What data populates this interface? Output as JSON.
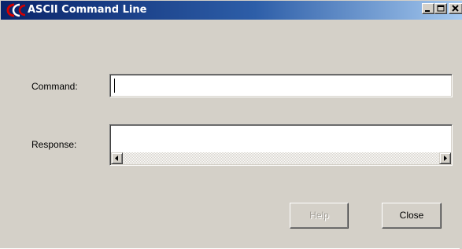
{
  "window": {
    "title": "ASCII Command Line",
    "icon": "app-logo-icon",
    "controls": {
      "minimize": "minimize-icon",
      "maximize": "maximize-icon",
      "close": "close-icon"
    }
  },
  "form": {
    "command_label": "Command:",
    "command_value": "",
    "response_label": "Response:",
    "response_value": ""
  },
  "buttons": {
    "help_label": "Help",
    "close_label": "Close"
  },
  "colors": {
    "title_gradient_start": "#0a246a",
    "title_gradient_end": "#a6caf0",
    "face": "#d4d0c8",
    "disabled_text": "#a09c94",
    "logo_red": "#d40000"
  }
}
